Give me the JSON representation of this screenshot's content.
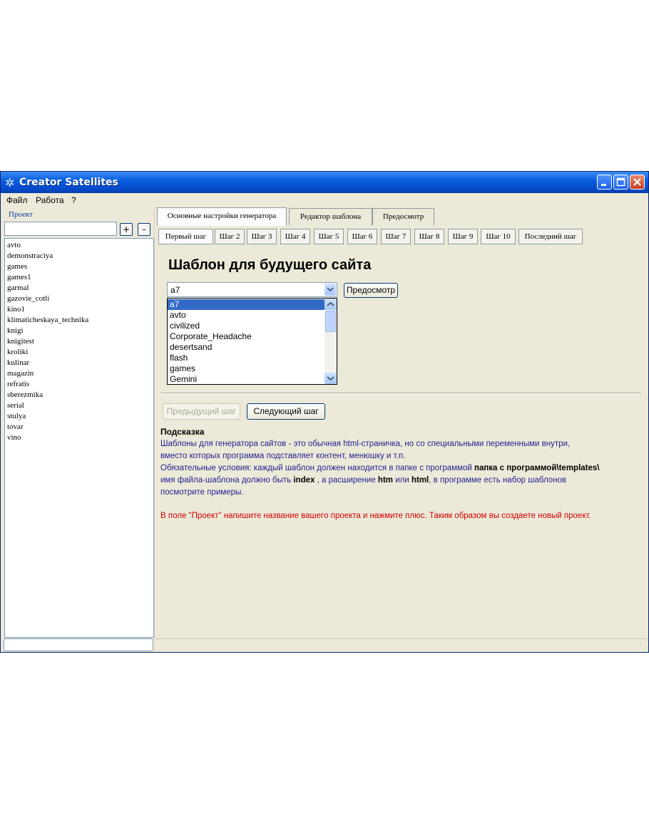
{
  "window": {
    "title": "Creator Satellites"
  },
  "menu": [
    "Файл",
    "Работа",
    "?"
  ],
  "project": {
    "label": "Проект",
    "input_value": "",
    "add_label": "+",
    "remove_label": "-",
    "items": [
      "avto",
      "demonstraciya",
      "games",
      "games1",
      "garmal",
      "gazovie_cotli",
      "kino1",
      "klimaticheskaya_technika",
      "knigi",
      "knigitest",
      "kroliki",
      "kulinar",
      "magazin",
      "refratis",
      "sberezmika",
      "serial",
      "stulya",
      "tovar",
      "vino"
    ]
  },
  "tabs": [
    "Основные настройки генератора",
    "Редактор шаблона",
    "Предосмотр"
  ],
  "steps": [
    "Первый шаг",
    "Шаг 2",
    "Шаг 3",
    "Шаг 4",
    "Шаг 5",
    "Шаг 6",
    "Шаг 7",
    "Шаг 8",
    "Шаг 9",
    "Шаг 10",
    "Последний шаг"
  ],
  "main": {
    "heading": "Шаблон  для будущего сайта",
    "template_value": "a7",
    "preview_button": "Предосмотр",
    "templates": [
      "a7",
      "avto",
      "civilized",
      "Corporate_Headache",
      "desertsand",
      "flash",
      "games",
      "Gemini"
    ],
    "prev_button": "Предыдущий шаг",
    "next_button": "Следующий шаг"
  },
  "hint": {
    "title": "Подсказка",
    "line1": "Шаблоны для генератора сайтов  - это обычная html-страничка, но со специальными переменными внутри,",
    "line2": "вместо которых программа подставляет контент, менюшку и т.п.",
    "line3_a": "Обязательные условия: каждый шаблон должен находится в папке с программой ",
    "line3_b": "папка с программой\\templates\\",
    "line4_a": "имя файла-шаблона должно быть ",
    "line4_b": "index",
    "line4_c": " , а расширение ",
    "line4_d": "htm",
    "line4_e": " или  ",
    "line4_f": "html",
    "line4_g": ", в программе есть набор шаблонов",
    "line5": "посмотрите примеры.",
    "warning": "В поле \"Проект\" напишите название вашего проекта и нажмите плюс. Таким образом вы создаете новый проект."
  },
  "colors": {
    "title_bar": "#0a5fe0",
    "window_bg": "#ece9d8",
    "selection": "#316ac5",
    "hint_text": "#1f1f8f",
    "warning_text": "#d40000"
  }
}
